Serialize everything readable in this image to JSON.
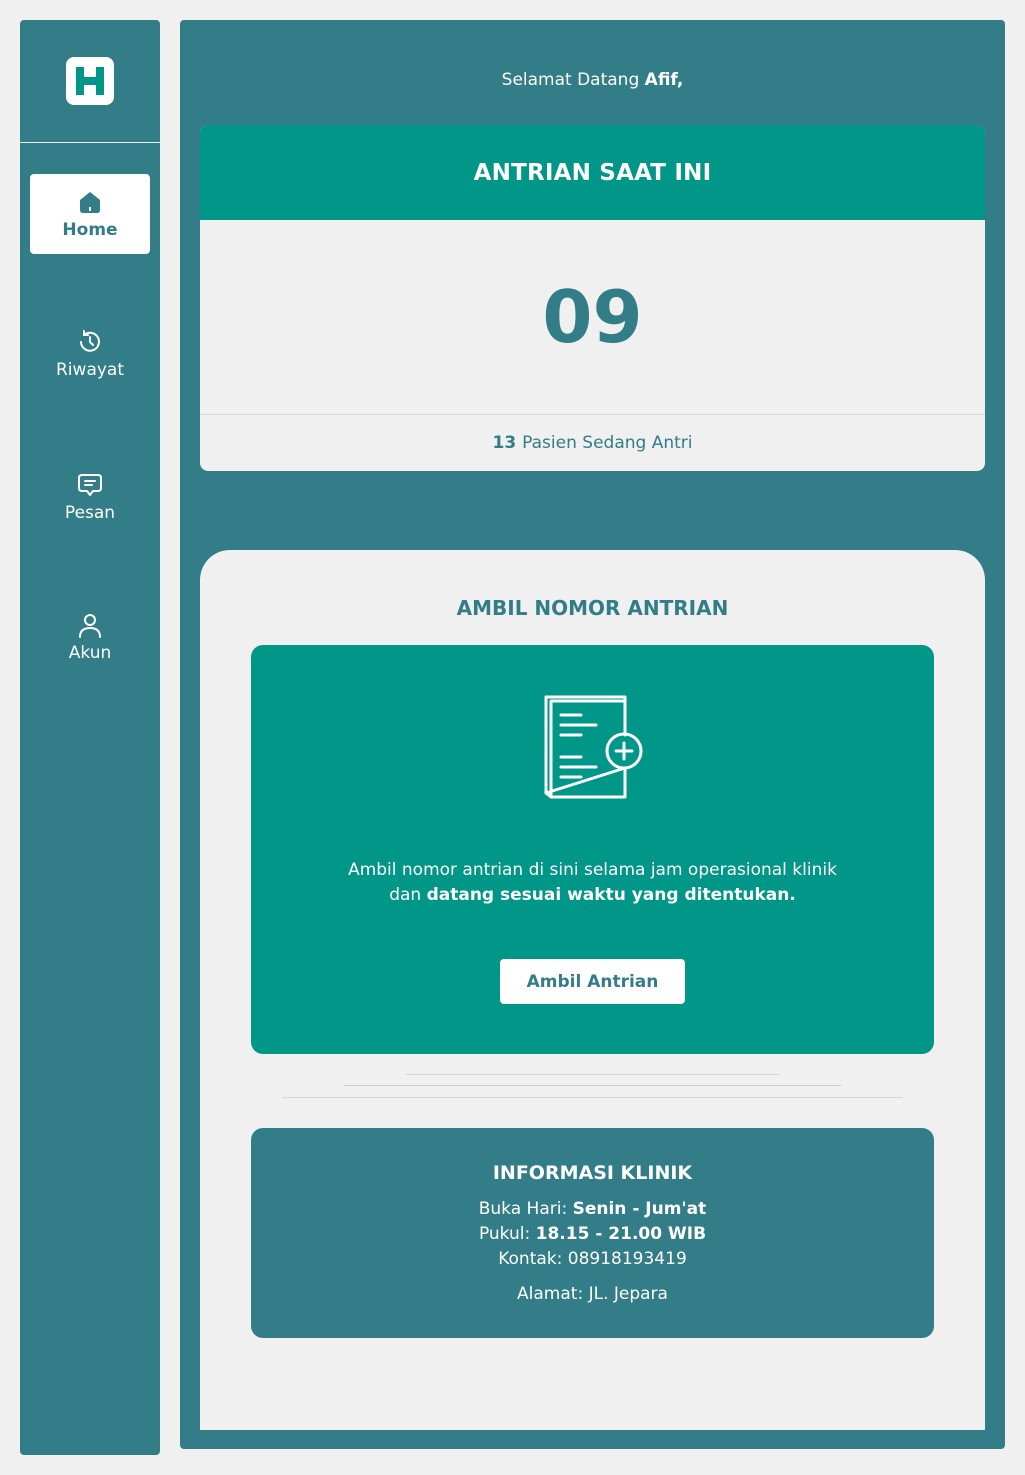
{
  "brand": {
    "logo_letter": "H",
    "logo_color": "#009688"
  },
  "colors": {
    "primary": "#327d88",
    "accent": "#009688",
    "background": "#f0f0f0"
  },
  "sidebar": {
    "items": [
      {
        "label": "Home",
        "icon": "home-icon",
        "active": true
      },
      {
        "label": "Riwayat",
        "icon": "history-icon",
        "active": false
      },
      {
        "label": "Pesan",
        "icon": "message-icon",
        "active": false
      },
      {
        "label": "Akun",
        "icon": "user-icon",
        "active": false
      }
    ]
  },
  "welcome": {
    "prefix": "Selamat Datang",
    "name": "Afif,"
  },
  "queue": {
    "title": "ANTRIAN SAAT INI",
    "current_number": "09",
    "waiting_count": "13",
    "waiting_label": "Pasien Sedang Antri"
  },
  "take_queue": {
    "title": "AMBIL NOMOR ANTRIAN",
    "icon": "document-add-icon",
    "desc_part1": "Ambil nomor antrian di sini selama jam operasional klinik",
    "desc_part2": "dan",
    "desc_bold": "datang sesuai waktu yang ditentukan.",
    "button_label": "Ambil Antrian"
  },
  "clinic_info": {
    "title": "INFORMASI KLINIK",
    "days_label": "Buka Hari:",
    "days_value": "Senin - Jum'at",
    "hours_label": "Pukul:",
    "hours_value": "18.15 - 21.00 WIB",
    "contact_label": "Kontak:",
    "contact_value": "08918193419",
    "address_label": "Alamat:",
    "address_value": "JL. Jepara"
  }
}
